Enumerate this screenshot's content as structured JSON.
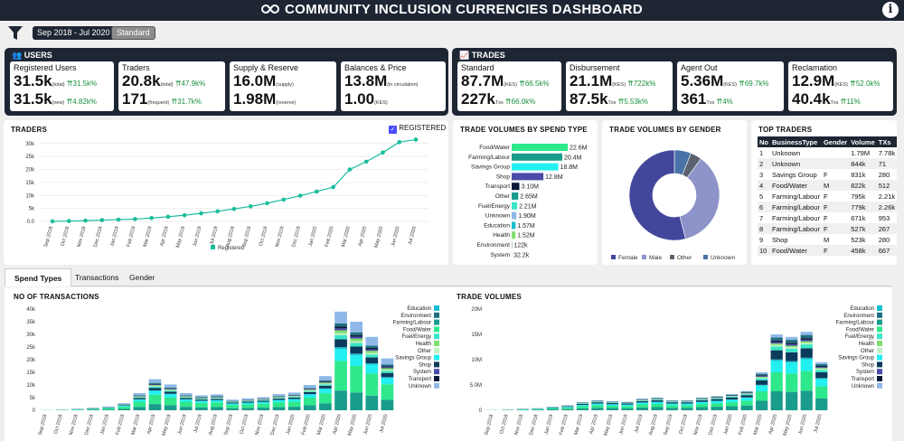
{
  "header": {
    "title": "COMMUNITY INCLUSION CURRENCIES DASHBOARD",
    "info_label": "i"
  },
  "filters": {
    "date_range": "Sep 2018 - Jul 2020",
    "token_type": "Standard"
  },
  "users": {
    "title": "USERS",
    "cards": [
      {
        "title": "Registered Users",
        "v1": "31.5k",
        "s1": "(total)",
        "c1": "31.5k%",
        "v2": "31.5k",
        "s2": "(new)",
        "c2": "4.82k%"
      },
      {
        "title": "Traders",
        "v1": "20.8k",
        "s1": "(total)",
        "c1": "47.9k%",
        "v2": "171",
        "s2": "(frequent)",
        "c2": "31.7k%"
      },
      {
        "title": "Supply & Reserve",
        "v1": "16.0M",
        "s1": "(supply)",
        "c1": "",
        "v2": "1.98M",
        "s2": "(reserve)",
        "c2": ""
      },
      {
        "title": "Balances & Price",
        "v1": "13.8M",
        "s1": "(in circulation)",
        "c1": "",
        "v2": "1.00",
        "s2": "(KES)",
        "c2": ""
      }
    ]
  },
  "trades": {
    "title": "TRADES",
    "cards": [
      {
        "title": "Standard",
        "v1": "87.7M",
        "s1": "(KES)",
        "c1": "66.5k%",
        "v2": "227k",
        "s2": "Txs",
        "c2": "66.0k%"
      },
      {
        "title": "Disbursement",
        "v1": "21.1M",
        "s1": "(KES)",
        "c1": "722k%",
        "v2": "87.5k",
        "s2": "Txs",
        "c2": "5.53k%"
      },
      {
        "title": "Agent Out",
        "v1": "5.36M",
        "s1": "(KES)",
        "c1": "69.7k%",
        "v2": "361",
        "s2": "Txs",
        "c2": "4%"
      },
      {
        "title": "Reclamation",
        "v1": "12.9M",
        "s1": "(KES)",
        "c1": "52.0k%",
        "v2": "40.4k",
        "s2": "Txs",
        "c2": "11%"
      }
    ]
  },
  "traders_chart": {
    "title": "TRADERS",
    "checkbox_label": "REGISTERED",
    "legend": "Registered",
    "color": "#1abc9c"
  },
  "spend_type_title": "TRADE VOLUMES BY SPEND TYPE",
  "gender_title": "TRADE VOLUMES BY GENDER",
  "gender_legend": [
    "Female",
    "Male",
    "Other",
    "Unknown"
  ],
  "top_traders": {
    "title": "TOP TRADERS",
    "headers": [
      "No",
      "BusinessType",
      "Gender",
      "Volume",
      "TXs"
    ],
    "rows": [
      [
        "1",
        "Unknown",
        "",
        "1.79M",
        "7.78k"
      ],
      [
        "2",
        "Unknown",
        "",
        "844k",
        "71"
      ],
      [
        "3",
        "Savings Group",
        "F",
        "831k",
        "280"
      ],
      [
        "4",
        "Food/Water",
        "M",
        "822k",
        "512"
      ],
      [
        "5",
        "Farming/Labour",
        "F",
        "795k",
        "2.21k"
      ],
      [
        "6",
        "Farming/Labour",
        "F",
        "779k",
        "2.26k"
      ],
      [
        "7",
        "Farming/Labour",
        "F",
        "671k",
        "953"
      ],
      [
        "8",
        "Farming/Labour",
        "F",
        "527k",
        "267"
      ],
      [
        "9",
        "Shop",
        "M",
        "523k",
        "280"
      ],
      [
        "10",
        "Food/Water",
        "F",
        "458k",
        "667"
      ]
    ]
  },
  "tabs": [
    "Spend Types",
    "Transactions",
    "Gender"
  ],
  "tx_title": "NO OF TRANSACTIONS",
  "vol_title": "TRADE VOLUMES",
  "months": [
    "Sep 2018",
    "Oct 2018",
    "Nov 2018",
    "Dec 2018",
    "Jan 2019",
    "Feb 2019",
    "Mar 2019",
    "Apr 2019",
    "May 2019",
    "Jun 2019",
    "Jul 2019",
    "Aug 2019",
    "Sep 2019",
    "Oct 2019",
    "Nov 2019",
    "Dec 2019",
    "Jan 2020",
    "Feb 2020",
    "Mar 2020",
    "Apr 2020",
    "May 2020",
    "Jun 2020",
    "Jul 2020"
  ],
  "spend_categories": [
    "Education",
    "Environment",
    "Farming/Labour",
    "Food/Water",
    "Fuel/Energy",
    "Health",
    "Other",
    "Savings Group",
    "Shop",
    "System",
    "Transport",
    "Unknown"
  ],
  "spend_colors": [
    "#17becf",
    "#1f6f7f",
    "#1a9c8c",
    "#2ee88c",
    "#39e6c6",
    "#7fe070",
    "#bff0c0",
    "#22f0f0",
    "#0c3a5c",
    "#4a4aa8",
    "#0a1a3a",
    "#8fb8e8"
  ],
  "chart_data": [
    {
      "type": "line",
      "title": "TRADERS",
      "x": [
        "Sep 2018",
        "Oct 2018",
        "Nov 2018",
        "Dec 2018",
        "Jan 2019",
        "Feb 2019",
        "Mar 2019",
        "Apr 2019",
        "May 2019",
        "Jun 2019",
        "Jul 2019",
        "Aug 2019",
        "Sep 2019",
        "Oct 2019",
        "Nov 2019",
        "Dec 2019",
        "Jan 2020",
        "Feb 2020",
        "Mar 2020",
        "Apr 2020",
        "May 2020",
        "Jun 2020",
        "Jul 2020"
      ],
      "series": [
        {
          "name": "Registered",
          "values": [
            30,
            150,
            300,
            500,
            700,
            900,
            1300,
            1800,
            2400,
            3100,
            3900,
            4800,
            5800,
            7000,
            8400,
            9900,
            11500,
            13200,
            20000,
            23000,
            26500,
            30500,
            31500
          ]
        }
      ],
      "ylim": [
        0,
        32000
      ],
      "yticks": [
        0,
        5000,
        10000,
        15000,
        20000,
        25000,
        30000
      ],
      "ytick_labels": [
        "0.0",
        "5k",
        "10k",
        "15k",
        "20k",
        "25k",
        "30k"
      ]
    },
    {
      "type": "bar",
      "title": "TRADE VOLUMES BY SPEND TYPE",
      "categories": [
        "Food/Water",
        "Farming/Labour",
        "Savings Group",
        "Shop",
        "Transport",
        "Other",
        "Fuel/Energy",
        "Unknown",
        "Education",
        "Health",
        "Environment",
        "System"
      ],
      "values": [
        22.6,
        20.4,
        18.8,
        12.8,
        3.1,
        2.65,
        2.21,
        1.9,
        1.57,
        1.52,
        0.122,
        0.0322
      ],
      "labels": [
        "22.6M",
        "20.4M",
        "18.8M",
        "12.8M",
        "3.10M",
        "2.65M",
        "2.21M",
        "1.90M",
        "1.57M",
        "1.52M",
        "122k",
        "32.2k"
      ],
      "colors": [
        "#2ee88c",
        "#1a9c8c",
        "#22f0f0",
        "#4a4aa8",
        "#0a1a3a",
        "#1a9c8c",
        "#39e6c6",
        "#8fb8e8",
        "#17becf",
        "#7fe070",
        "#1f6f7f",
        "#4a4aa8"
      ]
    },
    {
      "type": "pie",
      "title": "TRADE VOLUMES BY GENDER",
      "categories": [
        "Female",
        "Male",
        "Other",
        "Unknown"
      ],
      "values": [
        54,
        36,
        4,
        6
      ],
      "colors": [
        "#43479b",
        "#8e93c9",
        "#5a6270",
        "#4a74a8"
      ]
    },
    {
      "type": "bar",
      "title": "NO OF TRANSACTIONS",
      "stacked": true,
      "ylim": [
        0,
        40000
      ],
      "yticks": [
        0,
        5000,
        10000,
        15000,
        20000,
        25000,
        30000,
        35000,
        40000
      ],
      "ytick_labels": [
        "0",
        "5k",
        "10k",
        "15k",
        "20k",
        "25k",
        "30k",
        "35k",
        "40k"
      ],
      "totals": [
        100,
        300,
        600,
        1000,
        1500,
        2800,
        6800,
        12300,
        10200,
        6800,
        5900,
        6300,
        4200,
        4700,
        5200,
        6400,
        7000,
        10000,
        13500,
        39000,
        35000,
        29000,
        20500
      ]
    },
    {
      "type": "bar",
      "title": "TRADE VOLUMES",
      "stacked": true,
      "ylim": [
        0,
        20000000
      ],
      "yticks": [
        0,
        5000000,
        10000000,
        15000000,
        20000000
      ],
      "ytick_labels": [
        "0",
        "5.0M",
        "10M",
        "15M",
        "20M"
      ],
      "totals": [
        50000,
        150000,
        300000,
        400000,
        700000,
        1000000,
        1600000,
        2000000,
        1800000,
        1700000,
        2300000,
        2500000,
        2000000,
        2000000,
        2500000,
        2800000,
        3200000,
        3800000,
        7500000,
        15000000,
        14500000,
        15500000,
        9500000
      ]
    }
  ]
}
